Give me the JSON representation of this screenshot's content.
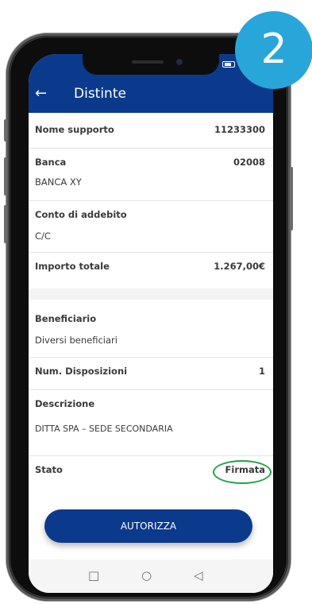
{
  "step_badge": "2",
  "header": {
    "back_icon": "←",
    "title": "Distinte"
  },
  "details": {
    "nome_supporto": {
      "label": "Nome supporto",
      "value": "11233300"
    },
    "banca": {
      "label": "Banca",
      "code": "02008",
      "name": "BANCA XY"
    },
    "conto": {
      "label": "Conto di addebito",
      "value": "C/C"
    },
    "importo": {
      "label": "Importo totale",
      "value": "1.267,00€"
    },
    "beneficiario": {
      "label": "Beneficiario",
      "value": "Diversi beneficiari"
    },
    "num_disposizioni": {
      "label": "Num. Disposizioni",
      "value": "1"
    },
    "descrizione": {
      "label": "Descrizione",
      "value": "DITTA SPA – SEDE SECONDARIA"
    },
    "stato": {
      "label": "Stato",
      "value": "Firmata"
    }
  },
  "actions": {
    "authorize_label": "AUTORIZZA"
  },
  "navbar": {
    "square": "□",
    "circle": "○",
    "back": "◁"
  },
  "colors": {
    "header": "#0b3a8d",
    "badge": "#29a6d9",
    "highlight": "#20a34a"
  }
}
